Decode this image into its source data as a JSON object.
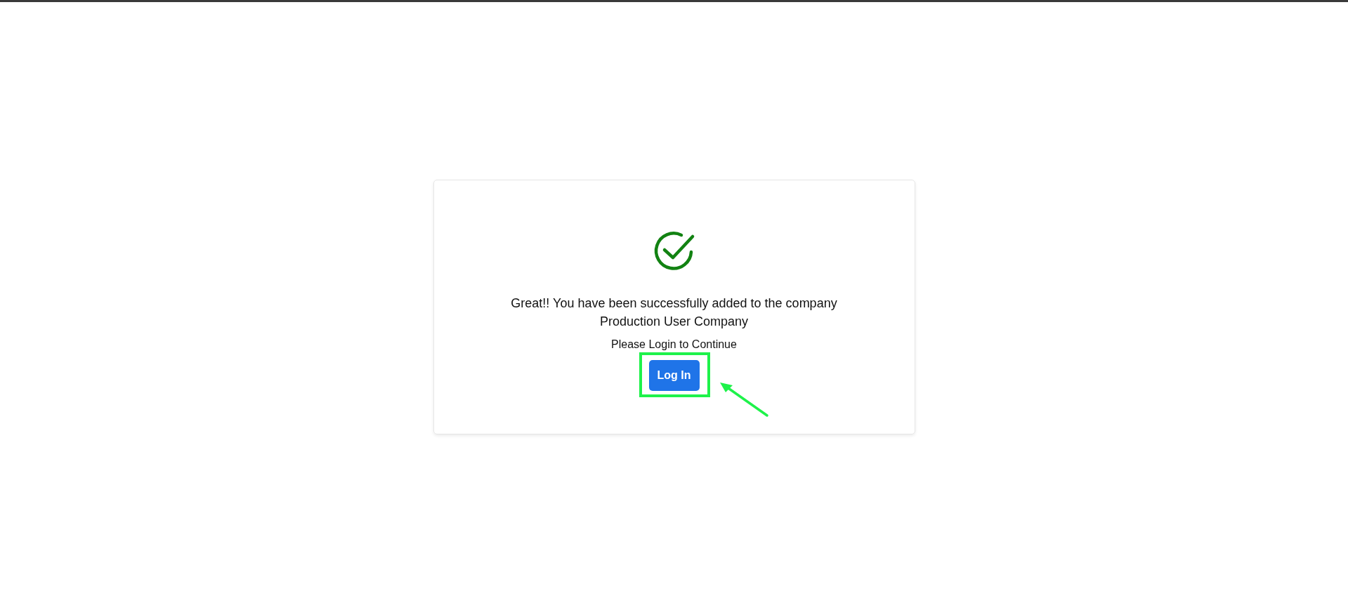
{
  "message": {
    "lines": [
      "Great!! You have been successfully added to the company",
      "Production User Company"
    ]
  },
  "prompt": "Please Login to Continue",
  "button": {
    "label": "Log In"
  },
  "annotation": {
    "kind": "highlight-arrow"
  }
}
